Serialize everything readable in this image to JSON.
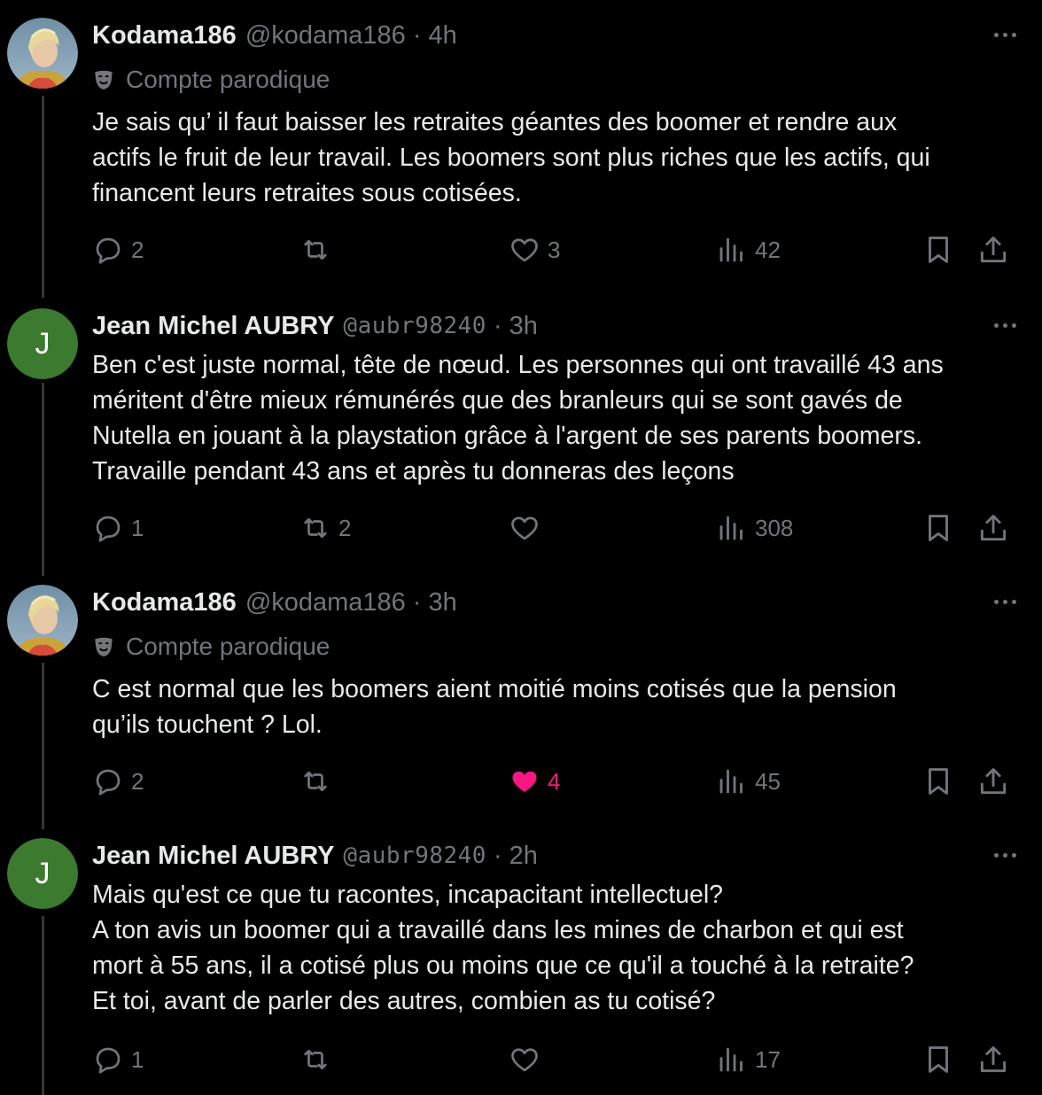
{
  "colors": {
    "background": "#000000",
    "text": "#e7e9ea",
    "muted": "#71767b",
    "like_active": "#f91880",
    "thread_line": "#333639",
    "avatar_j": "#3b7a2f"
  },
  "tweets": [
    {
      "author": "Kodama186",
      "handle": "@kodama186",
      "time": "4h",
      "avatar": "illustrated-portrait",
      "label_icon": "theater-mask-icon",
      "label": "Compte parodique",
      "lines": [
        "Je sais qu’ il faut baisser les retraites géantes des boomer et rendre aux",
        "actifs le fruit de leur travail. Les boomers sont plus riches que les actifs, qui",
        "financent leurs retraites sous cotisées."
      ],
      "replies": "2",
      "reposts": "",
      "likes": "3",
      "liked": false,
      "views": "42"
    },
    {
      "author": "Jean Michel AUBRY",
      "handle": "@aubr98240",
      "time": "3h",
      "avatar_letter": "J",
      "lines": [
        "Ben c'est juste normal, tête de nœud. Les personnes qui ont travaillé 43 ans",
        "méritent d'être mieux rémunérés que des branleurs qui se sont gavés de",
        "Nutella en jouant à la playstation grâce à l'argent de ses parents boomers.",
        "Travaille pendant 43 ans et après tu donneras des leçons"
      ],
      "replies": "1",
      "reposts": "2",
      "likes": "",
      "liked": false,
      "views": "308"
    },
    {
      "author": "Kodama186",
      "handle": "@kodama186",
      "time": "3h",
      "avatar": "illustrated-portrait",
      "label_icon": "theater-mask-icon",
      "label": "Compte parodique",
      "lines": [
        "C est normal que les boomers aient moitié moins cotisés que la pension",
        "qu’ils touchent ? Lol."
      ],
      "replies": "2",
      "reposts": "",
      "likes": "4",
      "liked": true,
      "views": "45"
    },
    {
      "author": "Jean Michel AUBRY",
      "handle": "@aubr98240",
      "time": "2h",
      "avatar_letter": "J",
      "lines": [
        "Mais qu'est ce que tu racontes, incapacitant intellectuel?",
        "A ton avis un boomer qui a travaillé dans les mines de charbon et qui est",
        "mort à 55 ans, il a cotisé plus ou moins que ce qu'il a touché à la retraite?",
        "Et toi, avant de parler des autres, combien as tu cotisé?"
      ],
      "replies": "1",
      "reposts": "",
      "likes": "",
      "liked": false,
      "views": "17"
    }
  ]
}
